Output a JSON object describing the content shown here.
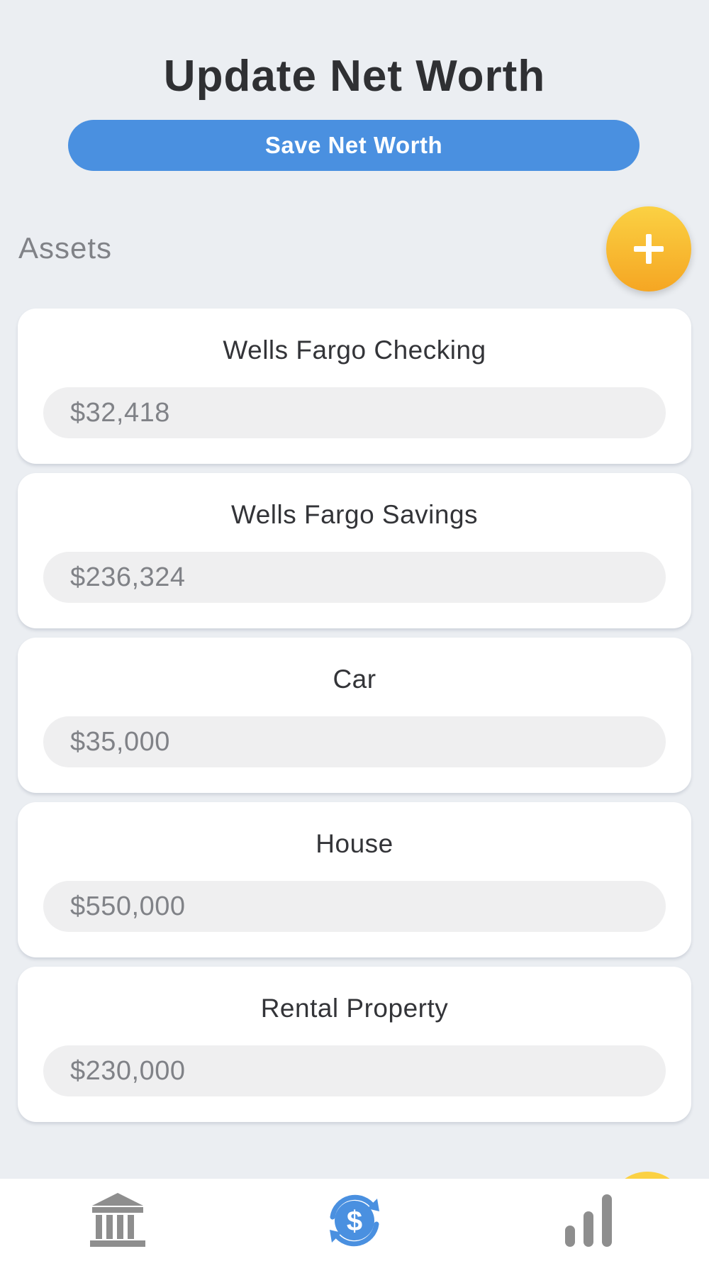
{
  "header": {
    "title": "Update Net Worth",
    "save_label": "Save Net Worth"
  },
  "assets": {
    "section_label": "Assets",
    "add_icon": "plus-icon",
    "items": [
      {
        "name": "Wells Fargo Checking",
        "value": "$32,418"
      },
      {
        "name": "Wells Fargo Savings",
        "value": "$236,324"
      },
      {
        "name": "Car",
        "value": "$35,000"
      },
      {
        "name": "House",
        "value": "$550,000"
      },
      {
        "name": "Rental Property",
        "value": "$230,000"
      }
    ]
  },
  "tabbar": {
    "tabs": [
      {
        "icon": "bank-icon",
        "active": false
      },
      {
        "icon": "dollar-refresh-icon",
        "active": true
      },
      {
        "icon": "bar-chart-icon",
        "active": false
      }
    ]
  },
  "colors": {
    "accent_blue": "#4a90e0",
    "fab_yellow": "#fbd143",
    "fab_orange": "#f5a623",
    "background": "#ebeef2",
    "inactive_icon": "#8e8e8e"
  }
}
